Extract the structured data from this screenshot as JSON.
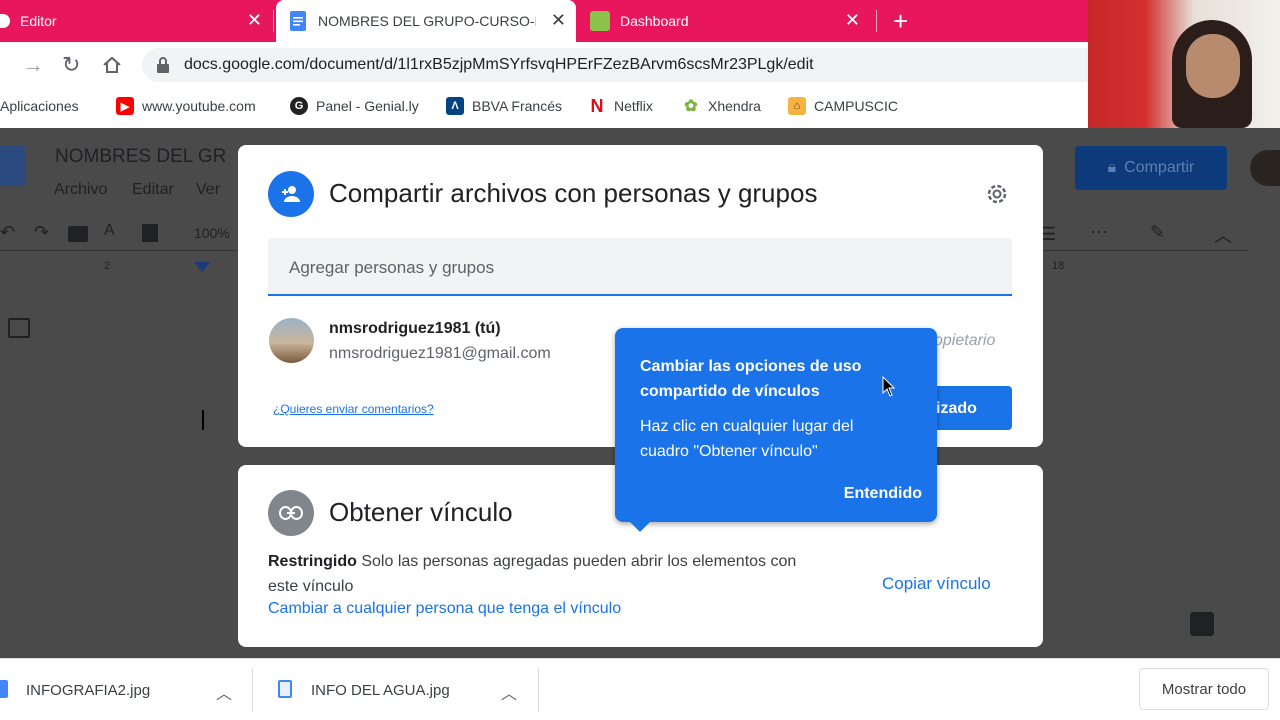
{
  "browser": {
    "tabs": [
      {
        "title": "Editor"
      },
      {
        "title": "NOMBRES DEL GRUPO-CURSO-I"
      },
      {
        "title": "Dashboard"
      }
    ],
    "url": "docs.google.com/document/d/1l1rxB5zjpMmSYrfsvqHPErFZezBArvm6scsMr23PLgk/edit",
    "bookmarks": [
      {
        "label": "Aplicaciones"
      },
      {
        "label": "www.youtube.com"
      },
      {
        "label": "Panel - Genial.ly"
      },
      {
        "label": "BBVA Francés"
      },
      {
        "label": "Netflix"
      },
      {
        "label": "Xhendra"
      },
      {
        "label": "CAMPUSCIC"
      }
    ]
  },
  "docs": {
    "title": "NOMBRES DEL GR",
    "menu": [
      "Archivo",
      "Editar",
      "Ver"
    ],
    "zoom": "100%",
    "share_button": "Compartir",
    "ruler_left": "2",
    "ruler_right": "18"
  },
  "share_dialog": {
    "title": "Compartir archivos con personas y grupos",
    "input_placeholder": "Agregar personas y grupos",
    "user_name": "nmsrodriguez1981 (tú)",
    "user_email": "nmsrodriguez1981@gmail.com",
    "role_partial": "opietario",
    "feedback_link": "¿Quieres enviar comentarios?",
    "done_partial": "izado"
  },
  "link_dialog": {
    "title": "Obtener vínculo",
    "restriction_label": "Restringido",
    "restriction_text": "Solo las personas agregadas pueden abrir los elementos con",
    "restriction_text2": "este vínculo",
    "change_link": "Cambiar a cualquier persona que tenga el vínculo",
    "copy_link": "Copiar vínculo"
  },
  "tooltip": {
    "title_line1": "Cambiar las opciones de uso",
    "title_line2": "compartido de vínculos",
    "body_line1": "Haz clic en cualquier lugar del",
    "body_line2": "cuadro \"Obtener vínculo\"",
    "button": "Entendido"
  },
  "downloads": {
    "items": [
      {
        "name": "INFOGRAFIA2.jpg"
      },
      {
        "name": "INFO DEL AGUA.jpg"
      }
    ],
    "show_all": "Mostrar todo"
  },
  "colors": {
    "tabstrip": "#e8175d",
    "accent_blue": "#1a73e8",
    "dim_overlay": "#4a4a4a"
  }
}
